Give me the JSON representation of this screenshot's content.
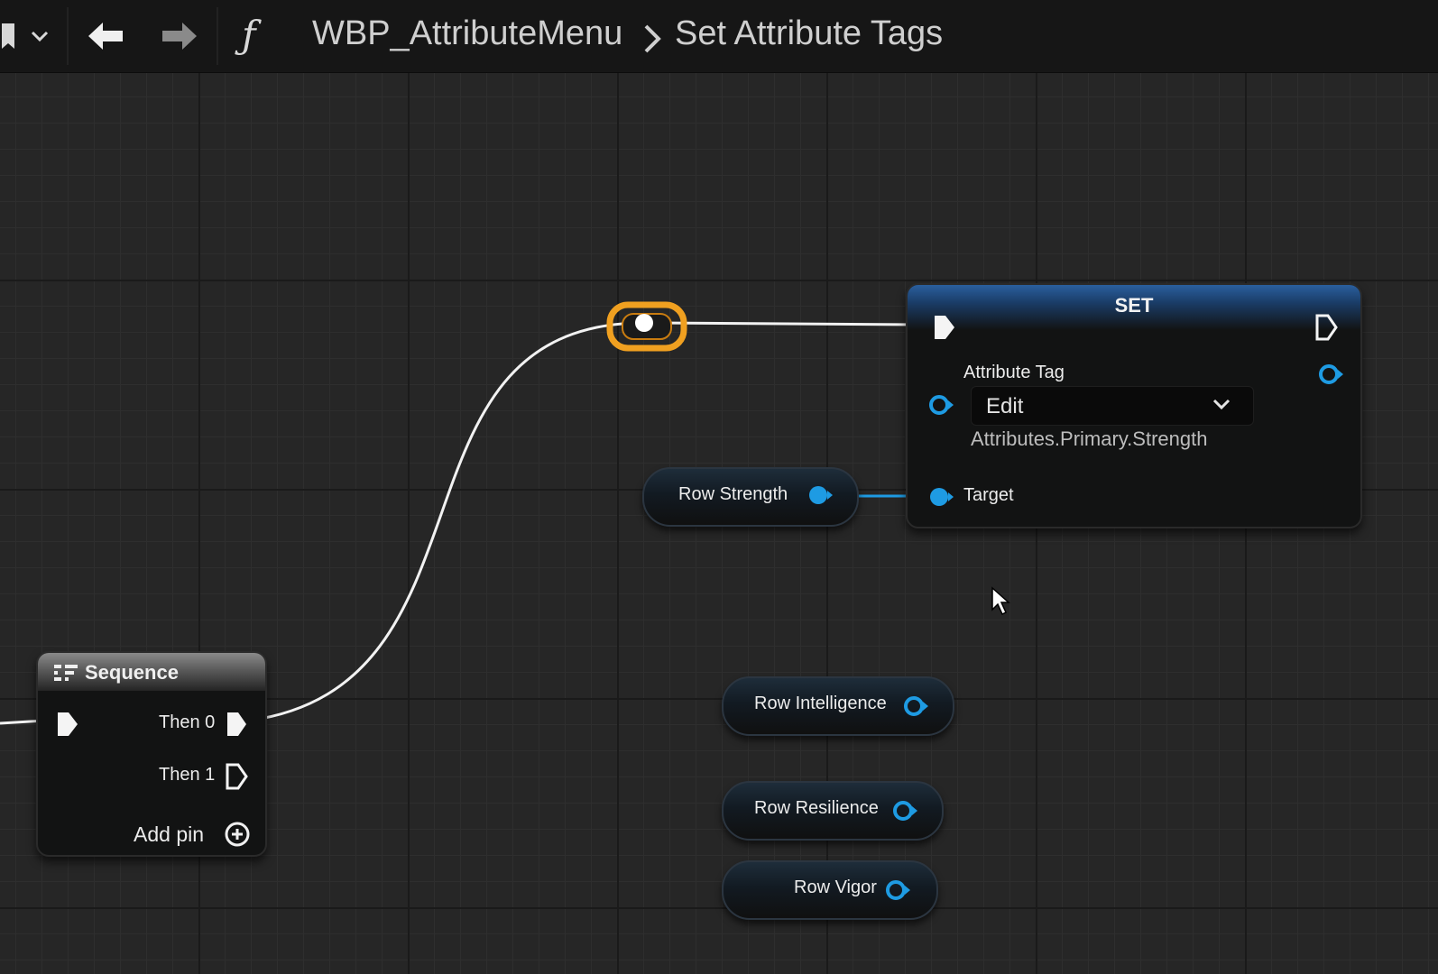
{
  "toolbar": {
    "breadcrumb_root": "WBP_AttributeMenu",
    "breadcrumb_current": "Set Attribute Tags",
    "function_glyph": "ƒ",
    "separator": "›"
  },
  "set_node": {
    "title": "SET",
    "property_label": "Attribute Tag",
    "dropdown_value": "Edit",
    "tag_value": "Attributes.Primary.Strength",
    "target_label": "Target"
  },
  "sequence_node": {
    "title": "Sequence",
    "then0": "Then 0",
    "then1": "Then 1",
    "add_pin": "Add pin"
  },
  "variables": {
    "row_strength": "Row Strength",
    "row_intelligence": "Row Intelligence",
    "row_resilience": "Row Resilience",
    "row_vigor": "Row Vigor"
  },
  "colors": {
    "object_pin": "#1e9be3",
    "exec_wire": "#f2f2f2",
    "reroute_highlight": "#f0a020",
    "set_header": "#2a5f9e"
  }
}
